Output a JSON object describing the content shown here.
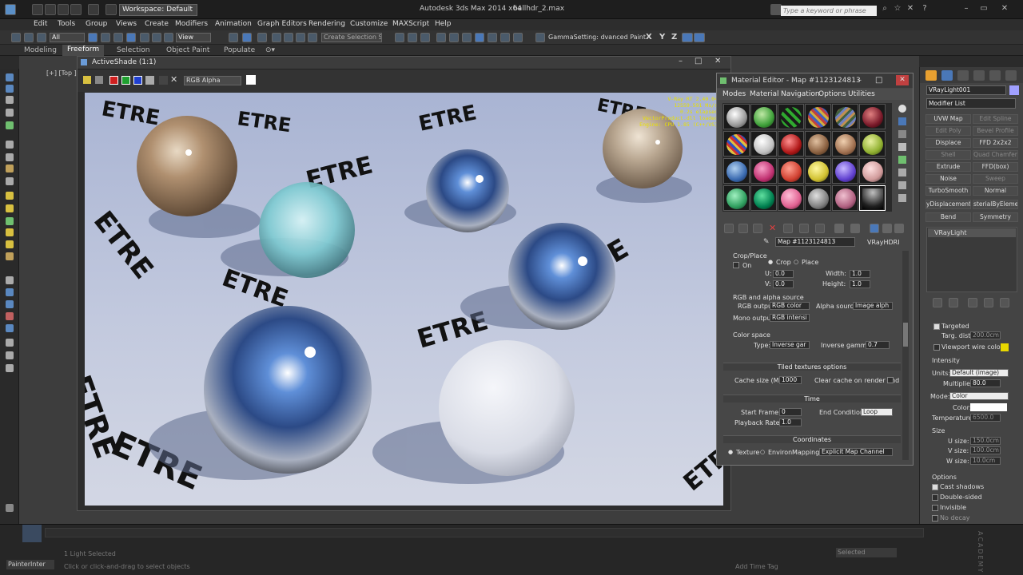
{
  "app": {
    "title": "Autodesk 3ds Max  2014 x64",
    "filename": "ballhdr_2.max",
    "workspace": "Workspace: Default",
    "search_placeholder": "Type a keyword or phrase"
  },
  "menu": [
    "Edit",
    "Tools",
    "Group",
    "Views",
    "Create",
    "Modifiers",
    "Animation",
    "Graph Editors",
    "Rendering",
    "Customize",
    "MAXScript",
    "Help"
  ],
  "toolbar": {
    "selection_filter": "All",
    "ref_coord": "View",
    "named_sel": "Create Selection Se",
    "gamma_label": "GammaSetting: dvanced Paint",
    "axes": [
      "X",
      "Y",
      "Z"
    ]
  },
  "ribbon": {
    "tabs": [
      "Modeling",
      "Freeform",
      "Selection",
      "Object Paint",
      "Populate"
    ],
    "active": "Freeform"
  },
  "viewport": {
    "label": "[+] [Top ]"
  },
  "activeshade": {
    "title": "ActiveShade (1:1)",
    "channel": "RGB Alpha",
    "stats": [
      "V-Ray RT 2.40.04",
      "12559.591 Ms/s",
      "0.2s elapsed",
      "VectorProduct.dll loaded",
      "Engine: CPU 1.85 (C++/VS)"
    ],
    "logo_text": "ETRE"
  },
  "material_editor": {
    "title": "Material Editor - Map #1123124813",
    "menus": [
      "Modes",
      "Material",
      "Navigation",
      "Options",
      "Utilities"
    ],
    "map_name": "Map #1123124813",
    "map_type": "VRayHDRI",
    "crop_place": {
      "section": "Crop/Place",
      "on_label": "On",
      "crop": "Crop",
      "place": "Place",
      "u_label": "U:",
      "u_val": "0.0",
      "v_label": "V:",
      "v_val": "0.0",
      "w_label": "Width:",
      "w_val": "1.0",
      "h_label": "Height:",
      "h_val": "1.0"
    },
    "rgb_alpha": {
      "section": "RGB and alpha source",
      "rgb_out_label": "RGB output:",
      "rgb_out": "RGB color",
      "alpha_src_label": "Alpha source:",
      "alpha_src": "Image alph",
      "mono_label": "Mono output:",
      "mono": "RGB intensi"
    },
    "color_space": {
      "section": "Color space",
      "type_label": "Type:",
      "type_val": "Inverse gar",
      "gamma_label": "Inverse gamma:",
      "gamma_val": "0.7"
    },
    "tiled": {
      "rollout": "Tiled textures options",
      "cache_label": "Cache size (MB):",
      "cache_val": "1000",
      "clear_label": "Clear cache on render end"
    },
    "time": {
      "rollout": "Time",
      "start_label": "Start Frame:",
      "start_val": "0",
      "end_label": "End Condition:",
      "end_val": "Loop",
      "rate_label": "Playback Rate:",
      "rate_val": "1.0"
    },
    "coords": {
      "rollout": "Coordinates",
      "texture": "Texture",
      "environ": "Environ",
      "mapping_label": "Mapping:",
      "mapping_val": "Explicit Map Channel"
    }
  },
  "command_panel": {
    "object_name": "VRayLight001",
    "modifier_list": "Modifier List",
    "modifiers": [
      "UVW Map",
      "Edit Spline",
      "Edit Poly",
      "Bevel Profile",
      "Displace",
      "FFD 2x2x2",
      "Shell",
      "Quad Chamfer",
      "Extrude",
      "FFD(box)",
      "Noise",
      "Sweep",
      "TurboSmooth",
      "Normal",
      "yDisplacement",
      "sterialByEleme",
      "Bend",
      "Symmetry"
    ],
    "stack_item": "VRayLight",
    "targeted": "Targeted",
    "targ_dist_label": "Targ. dist:",
    "targ_dist": "200.0cm",
    "viewport_wire": "Viewport wire color",
    "intensity": "Intensity",
    "units_label": "Units:",
    "units": "Default (image)",
    "mult_label": "Multiplier:",
    "mult": "80.0",
    "mode_label": "Mode:",
    "mode": "Color",
    "color_label": "Color:",
    "temp_label": "Temperature:",
    "temp": "6500.0",
    "size": "Size",
    "usize_label": "U size:",
    "usize": "150.0cm",
    "vsize_label": "V size:",
    "vsize": "100.0cm",
    "wsize_label": "W size:",
    "wsize": "10.0cm",
    "options": "Options",
    "cast_shadows": "Cast shadows",
    "double_sided": "Double-sided",
    "invisible": "Invisible",
    "no_decay": "No decay",
    "wire_color": "#e8d800"
  },
  "status": {
    "script": "PainterInter",
    "selected": "1 Light Selected",
    "hint": "Click or click-and-drag to select objects",
    "time_tag": "Add Time Tag",
    "selected_field": "Selected"
  },
  "watermark": "ACADEMY"
}
